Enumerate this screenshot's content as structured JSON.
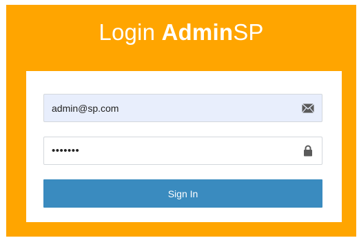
{
  "header": {
    "title_prefix": "Login ",
    "title_bold": "Admin",
    "title_suffix": "SP"
  },
  "form": {
    "email": {
      "value": "admin@sp.com",
      "icon": "envelope-icon"
    },
    "password": {
      "value": "•••••••",
      "icon": "lock-icon"
    },
    "submit_label": "Sign In"
  },
  "colors": {
    "panel": "#ffa500",
    "button": "#3a8bbf",
    "email_autofill_bg": "#e8eefc"
  }
}
